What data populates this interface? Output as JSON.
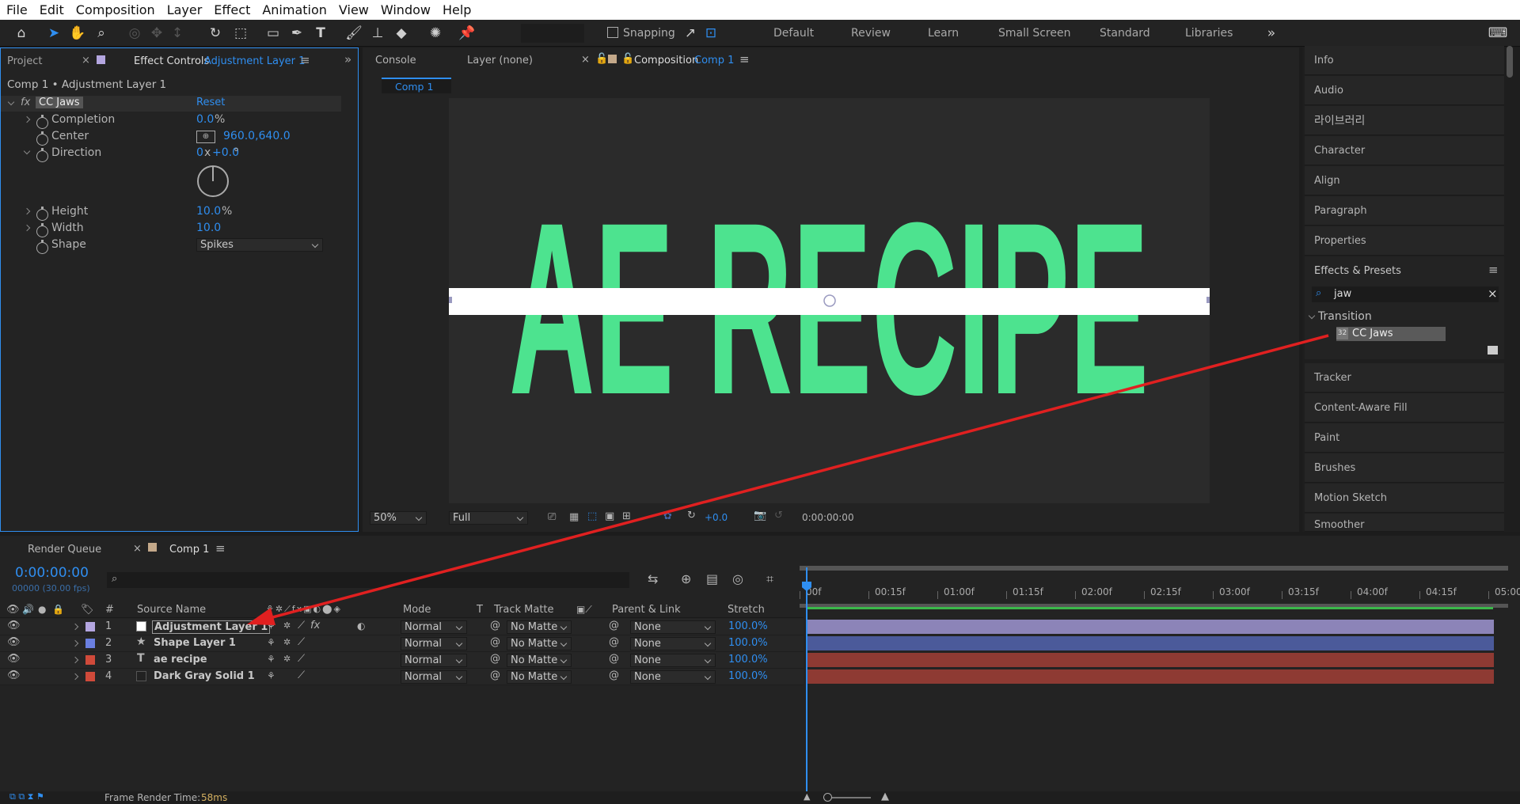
{
  "menu": [
    "File",
    "Edit",
    "Composition",
    "Layer",
    "Effect",
    "Animation",
    "View",
    "Window",
    "Help"
  ],
  "toolbar": {
    "snapping": "Snapping",
    "workspaces": [
      "Default",
      "Review",
      "Learn",
      "Small Screen",
      "Standard",
      "Libraries"
    ]
  },
  "left_panel": {
    "tab_project": "Project",
    "tab_effect": "Effect Controls",
    "tab_effect_layer": "Adjustment Layer 1",
    "breadcrumb": "Comp 1 • Adjustment Layer 1",
    "effect_name": "CC Jaws",
    "reset": "Reset",
    "props": [
      {
        "name": "Completion",
        "value": "0.0",
        "unit": "%"
      },
      {
        "name": "Center",
        "value": "960.0,640.0"
      },
      {
        "name": "Direction",
        "value": "0",
        "value2": "+0.0",
        "unit": "°",
        "x": "x"
      },
      {
        "name": "Height",
        "value": "10.0",
        "unit": "%"
      },
      {
        "name": "Width",
        "value": "10.0"
      },
      {
        "name": "Shape",
        "value": "Spikes"
      }
    ]
  },
  "viewer": {
    "tab_console": "Console",
    "tab_layer": "Layer (none)",
    "tab_comp": "Composition",
    "tab_comp_name": "Comp 1",
    "crumb": "Comp 1",
    "canvas_text": "AE RECIPE",
    "text_color": "#4de38f",
    "zoom": "50%",
    "resolution": "Full",
    "exposure": "+0.0",
    "timecode": "0:00:00:00"
  },
  "right_panel": {
    "items_top": [
      "Info",
      "Audio",
      "라이브러리",
      "Character",
      "Align",
      "Paragraph",
      "Properties"
    ],
    "effects_title": "Effects & Presets",
    "search": "jaw",
    "category": "Transition",
    "result": "CC Jaws",
    "items_bottom": [
      "Tracker",
      "Content-Aware Fill",
      "Paint",
      "Brushes",
      "Motion Sketch",
      "Smoother"
    ]
  },
  "timeline": {
    "tab_render": "Render Queue",
    "tab_comp": "Comp 1",
    "time": "0:00:00:00",
    "fps": "00000 (30.00 fps)",
    "headers": {
      "num": "#",
      "source": "Source Name",
      "mode": "Mode",
      "t": "T",
      "matte": "Track Matte",
      "parent": "Parent & Link",
      "stretch": "Stretch"
    },
    "ruler": [
      "00f",
      "00:15f",
      "01:00f",
      "01:15f",
      "02:00f",
      "02:15f",
      "03:00f",
      "03:15f",
      "04:00f",
      "04:15f",
      "05:00"
    ],
    "layers": [
      {
        "num": "1",
        "name": "Adjustment Layer 1",
        "label": "#b4a6e0",
        "mode": "Normal",
        "matte": "No Matte",
        "parent": "None",
        "stretch": "100.0%",
        "bar": "#8c84b8"
      },
      {
        "num": "2",
        "name": "Shape Layer 1",
        "label": "#6a7fe0",
        "mode": "Normal",
        "matte": "No Matte",
        "parent": "None",
        "stretch": "100.0%",
        "bar": "#4b5a9a"
      },
      {
        "num": "3",
        "name": "ae recipe",
        "label": "#d04a3a",
        "mode": "Normal",
        "matte": "No Matte",
        "parent": "None",
        "stretch": "100.0%",
        "bar": "#8e3a33"
      },
      {
        "num": "4",
        "name": "Dark Gray Solid 1",
        "label": "#d04a3a",
        "mode": "Normal",
        "matte": "No Matte",
        "parent": "None",
        "stretch": "100.0%",
        "bar": "#8e3a33"
      }
    ],
    "footer_label": "Frame Render Time:",
    "footer_value": "58ms"
  },
  "colors": {
    "accent": "#2f8ef0",
    "arrow": "#e02020"
  }
}
